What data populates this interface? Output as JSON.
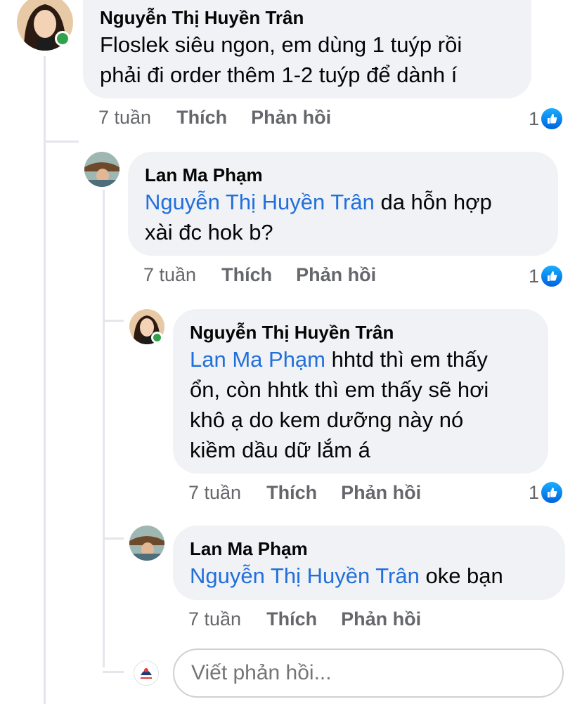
{
  "comments": [
    {
      "author": "Nguyễn Thị Huyền Trân",
      "mention": "",
      "text_line1": "Floslek siêu ngon, em dùng 1 tuýp rồi",
      "text_line2": "phải đi order thêm 1-2 tuýp để dành í",
      "time": "7 tuần",
      "like_label": "Thích",
      "reply_label": "Phản hồi",
      "reaction_count": "1",
      "online": true
    },
    {
      "author": "Lan Ma Phạm",
      "mention": "Nguyễn Thị Huyền Trân",
      "text_line1": " da hỗn hợp",
      "text_line2": "xài đc hok b?",
      "time": "7 tuần",
      "like_label": "Thích",
      "reply_label": "Phản hồi",
      "reaction_count": "1",
      "online": false
    },
    {
      "author": "Nguyễn Thị Huyền Trân",
      "mention": "Lan Ma Phạm",
      "text_line1": " hhtd thì em thấy",
      "text_line2": "ổn, còn hhtk thì em thấy sẽ hơi",
      "text_line3": "khô ạ do kem dưỡng này nó",
      "text_line4": "kiềm dầu dữ lắm á",
      "time": "7 tuần",
      "like_label": "Thích",
      "reply_label": "Phản hồi",
      "reaction_count": "1",
      "online": true
    },
    {
      "author": "Lan Ma Phạm",
      "mention": "Nguyễn Thị Huyền Trân",
      "text_line1": " oke bạn",
      "time": "7 tuần",
      "like_label": "Thích",
      "reply_label": "Phản hồi",
      "online": false
    }
  ],
  "reply_box": {
    "placeholder": "Viết phản hồi..."
  },
  "colors": {
    "mention": "#216fdb",
    "bubble": "#f0f2f5",
    "online": "#31a24c",
    "like": "#1877f2"
  }
}
